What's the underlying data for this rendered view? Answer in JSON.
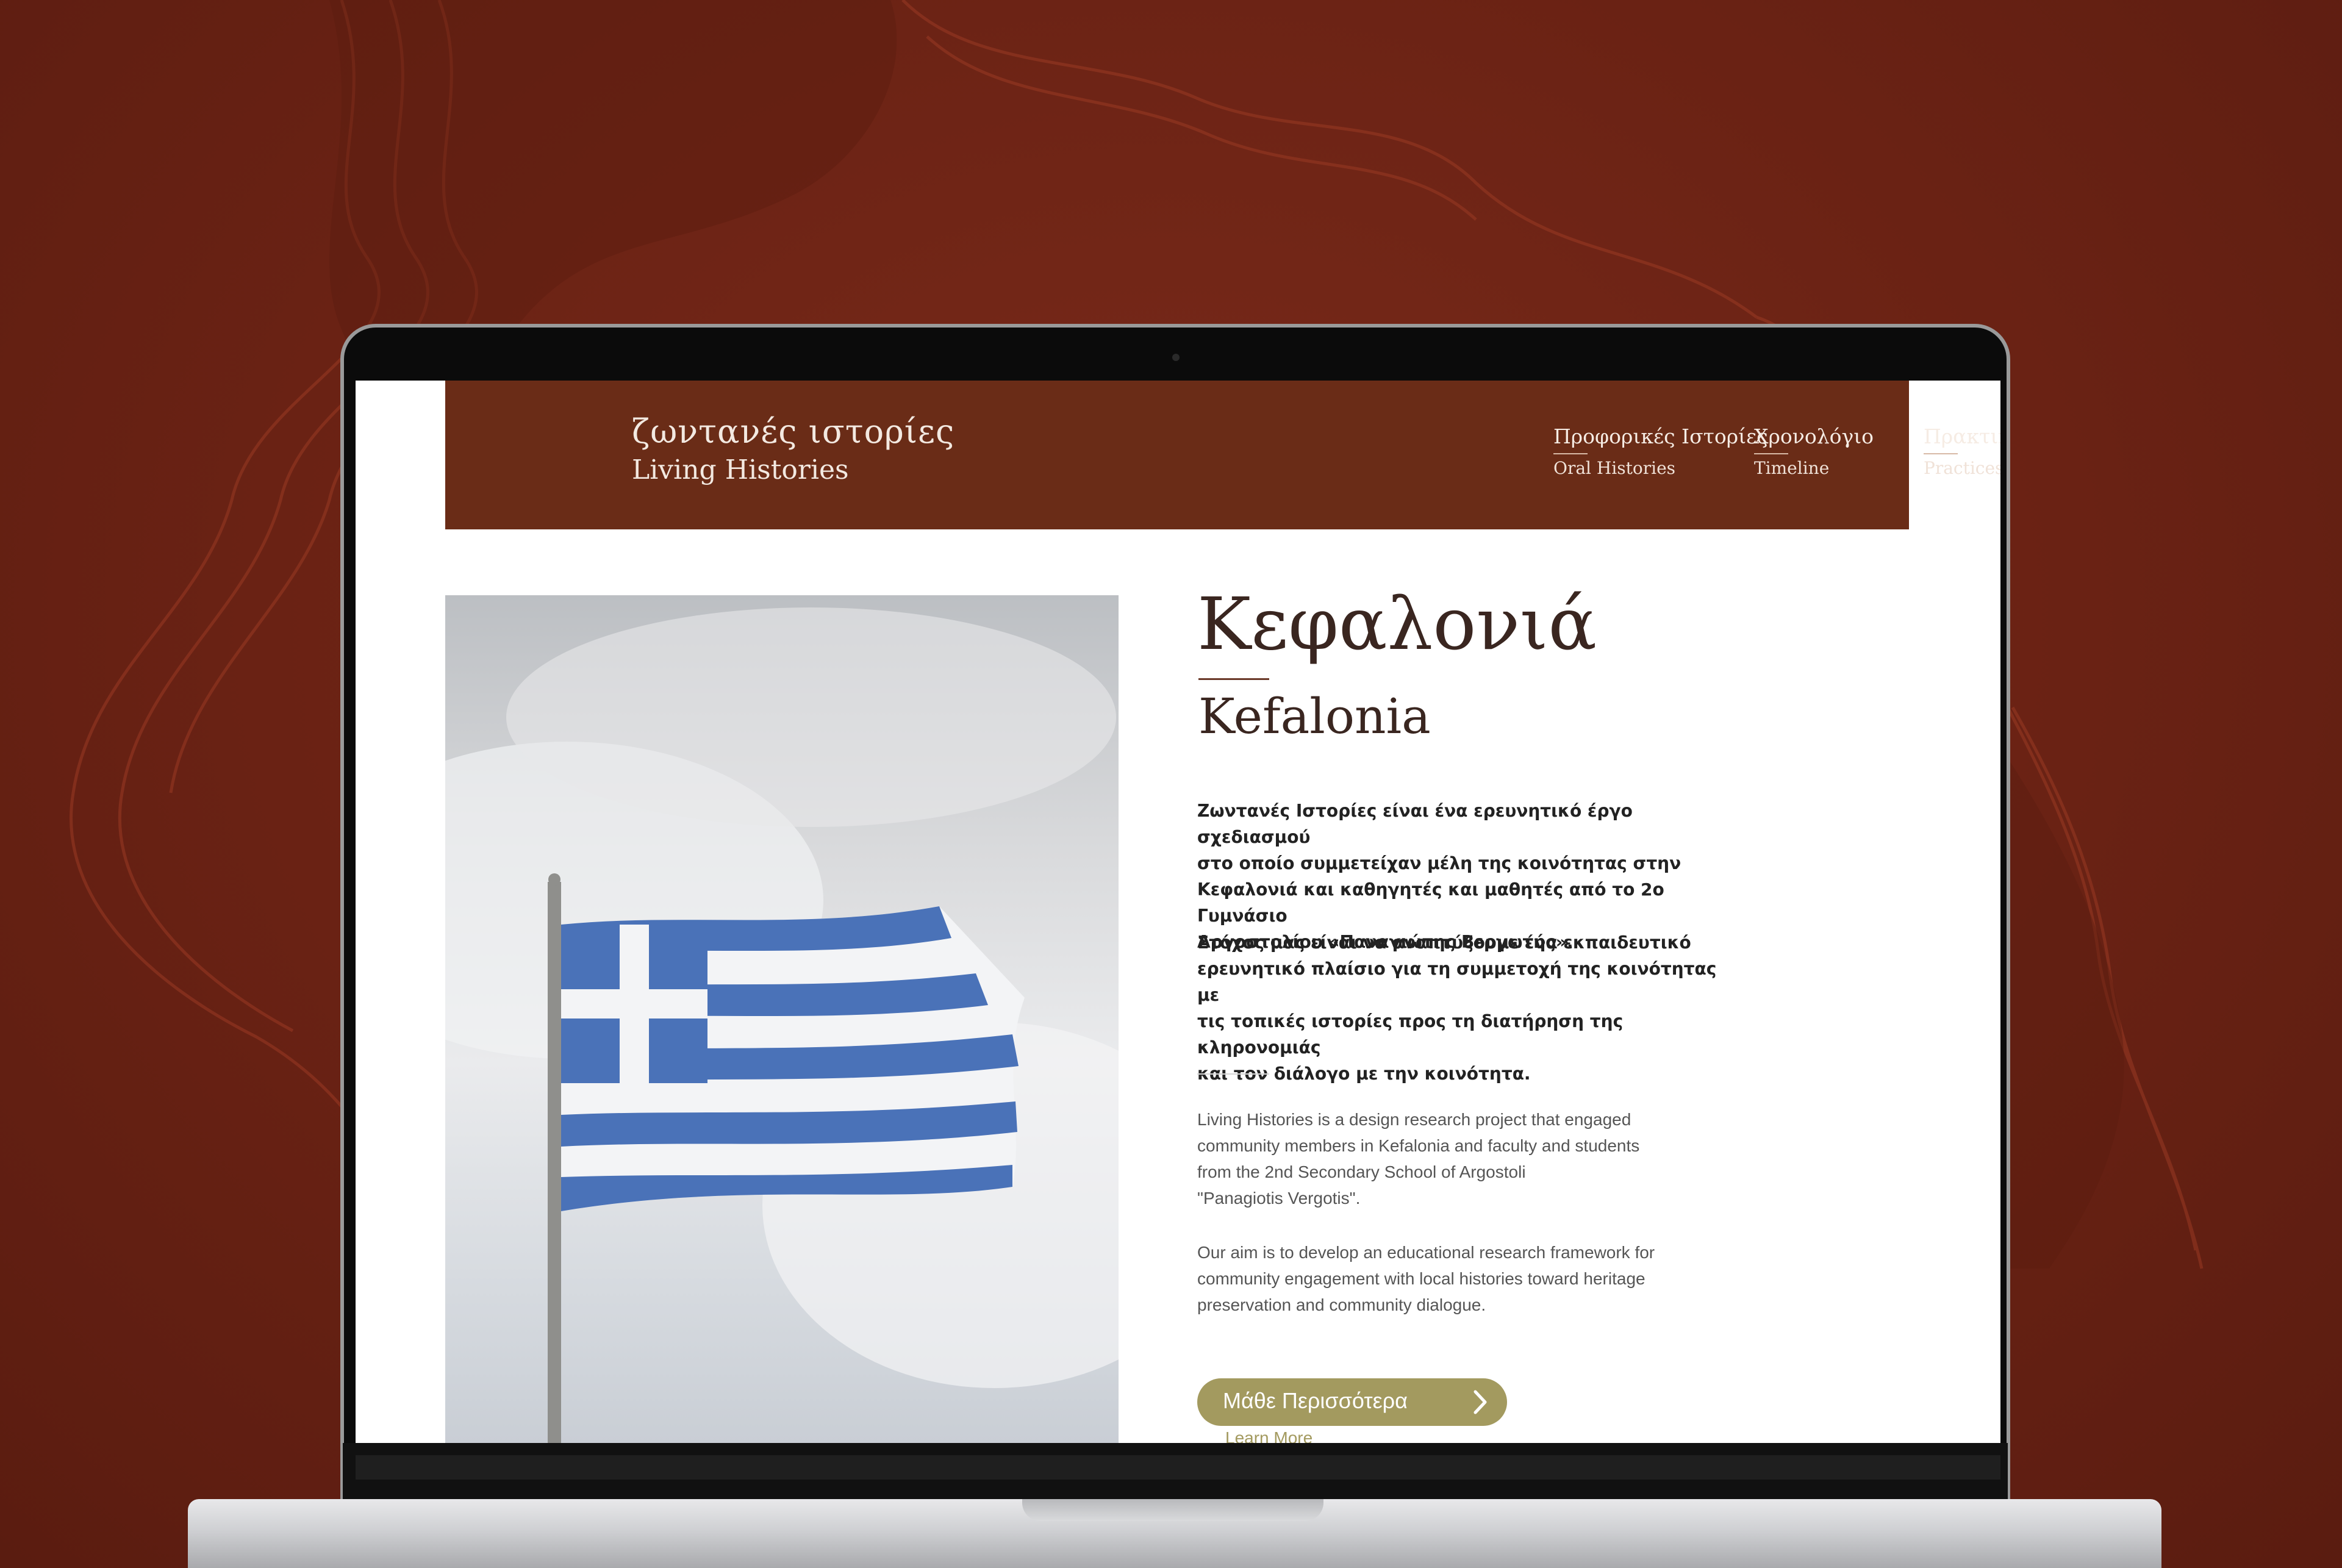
{
  "site": {
    "logo": {
      "greek": "ζωντανές ιστορίες",
      "english": "Living Histories"
    },
    "nav": [
      {
        "greek": "Προφορικές Ιστορίες",
        "english": "Oral Histories"
      },
      {
        "greek": "Χρονολόγιο",
        "english": "Timeline"
      },
      {
        "greek": "Πρακτικές",
        "english": "Practices"
      }
    ]
  },
  "page": {
    "title_greek": "Κεφαλονιά",
    "title_english": "Kefalonia",
    "paragraphs_greek": [
      [
        "Ζωντανές Ιστορίες είναι ένα ερευνητικό έργο σχεδιασμού",
        "στο οποίο συμμετείχαν μέλη της κοινότητας στην",
        "Κεφαλονιά και καθηγητές και μαθητές από το 2ο Γυμνάσιο",
        "Αργοστολίου «Παναγιώτης Βεργωτής»."
      ],
      [
        "Στόχος μας είναι να αναπτύξουμε ένα εκπαιδευτικό",
        "ερευνητικό πλαίσιο για τη συμμετοχή της κοινότητας με",
        "τις τοπικές ιστορίες προς τη διατήρηση της κληρονομιάς",
        "και τον διάλογο με την κοινότητα."
      ]
    ],
    "paragraphs_english": [
      [
        "Living Histories is a design research project that engaged",
        "community members in Kefalonia and faculty and students",
        "from the 2nd Secondary School of Argostoli",
        "\"Panagiotis Vergotis\"."
      ],
      [
        "Our aim is to develop an educational research framework for",
        "community engagement with local histories toward heritage",
        "preservation and community dialogue."
      ]
    ],
    "cta": {
      "label": "Μάθε Περισσότερα",
      "sublabel": "Learn More"
    }
  },
  "colors": {
    "background": "#6a2214",
    "header": "#6a2c17",
    "button": "#a39a5f",
    "flag_blue": "#4a72b8"
  },
  "icons": [
    "chevron-right-icon",
    "webcam-icon"
  ]
}
